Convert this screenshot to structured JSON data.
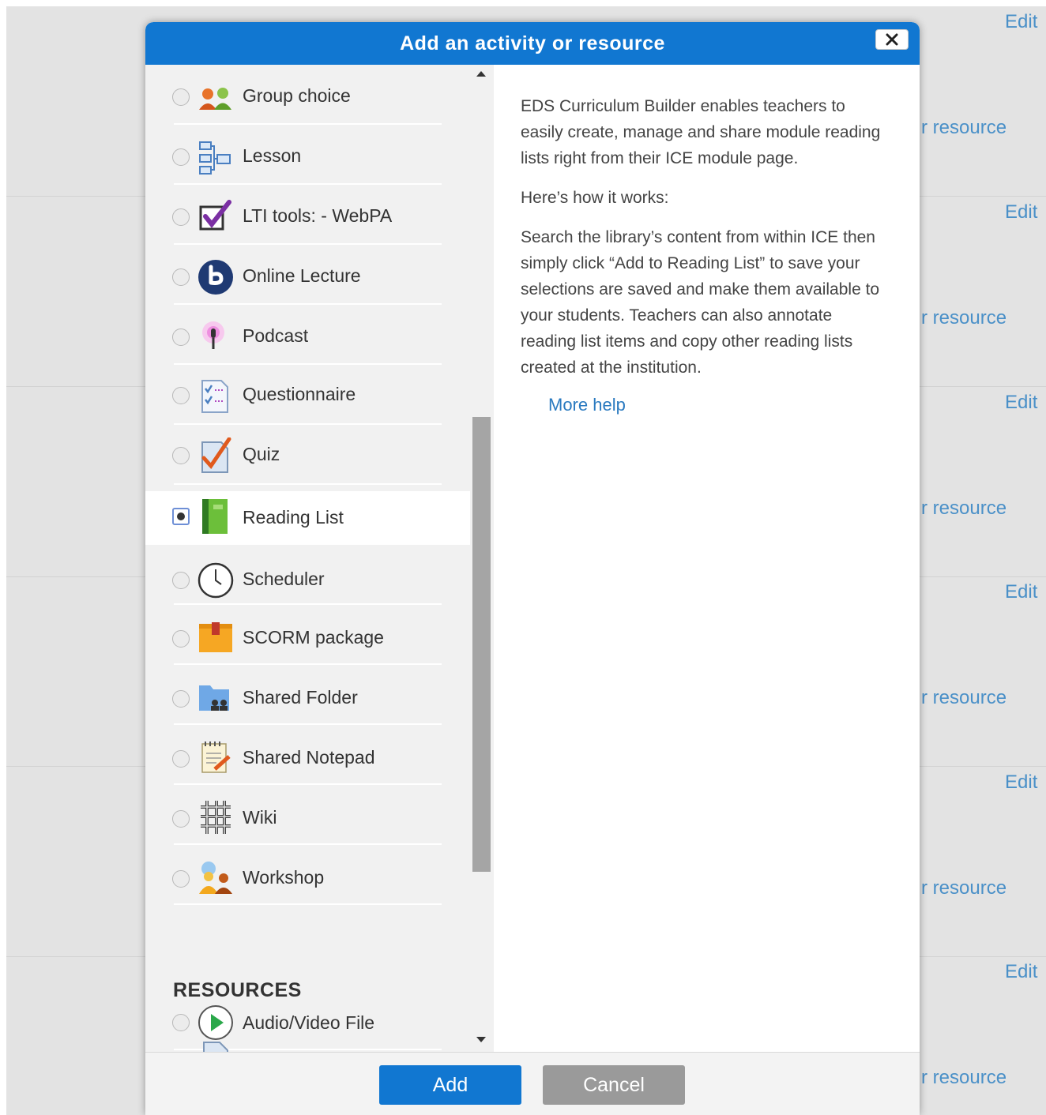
{
  "background": {
    "edit_label": "Edit",
    "add_resource_fragment": "r resource"
  },
  "dialog": {
    "title": "Add an activity or resource",
    "options": [
      {
        "label": "Group choice",
        "icon": "group-choice-icon",
        "selected": false
      },
      {
        "label": "Lesson",
        "icon": "lesson-icon",
        "selected": false
      },
      {
        "label": "LTI tools: - WebPA",
        "icon": "lti-tools-icon",
        "selected": false
      },
      {
        "label": "Online Lecture",
        "icon": "online-lecture-icon",
        "selected": false
      },
      {
        "label": "Podcast",
        "icon": "podcast-icon",
        "selected": false
      },
      {
        "label": "Questionnaire",
        "icon": "questionnaire-icon",
        "selected": false
      },
      {
        "label": "Quiz",
        "icon": "quiz-icon",
        "selected": false
      },
      {
        "label": "Reading List",
        "icon": "reading-list-icon",
        "selected": true
      },
      {
        "label": "Scheduler",
        "icon": "scheduler-icon",
        "selected": false
      },
      {
        "label": "SCORM package",
        "icon": "scorm-package-icon",
        "selected": false
      },
      {
        "label": "Shared Folder",
        "icon": "shared-folder-icon",
        "selected": false
      },
      {
        "label": "Shared Notepad",
        "icon": "shared-notepad-icon",
        "selected": false
      },
      {
        "label": "Wiki",
        "icon": "wiki-icon",
        "selected": false
      },
      {
        "label": "Workshop",
        "icon": "workshop-icon",
        "selected": false
      }
    ],
    "resources_heading": "RESOURCES",
    "resources": [
      {
        "label": "Audio/Video File",
        "icon": "audio-video-file-icon",
        "selected": false
      }
    ],
    "help": {
      "paragraphs": [
        "EDS Curriculum Builder enables teachers to easily create, manage and share module reading lists right from their ICE module page.",
        "Here’s how it works:",
        "Search the library’s content from within ICE then simply click “Add to Reading List” to save your selections are saved and make them available to your students. Teachers can also annotate reading list items and copy other reading lists created at the institution."
      ],
      "more_help": "More help"
    },
    "buttons": {
      "add": "Add",
      "cancel": "Cancel"
    },
    "colors": {
      "header": "#1177d1",
      "add_button": "#1177d1",
      "cancel_button": "#9a9a9a",
      "link": "#2a7ac0"
    }
  }
}
